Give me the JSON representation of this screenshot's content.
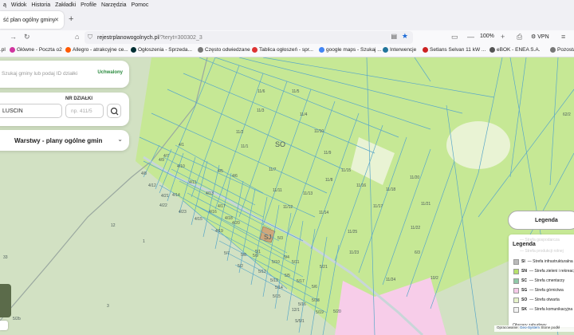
{
  "menu": [
    "ą",
    "Widok",
    "Historia",
    "Zakładki",
    "Profile",
    "Narzędzia",
    "Pomoc"
  ],
  "tab": {
    "title": "ść plan ogólny gminy"
  },
  "url": {
    "domain": "rejestrplanowogolnych.pl",
    "path": "/?teryt=300302_3",
    "zoom": "100%",
    "vpn": "VPN"
  },
  "bookmarks": [
    {
      "label": ".pl",
      "color": "#d33"
    },
    {
      "label": "Główne - Poczta o2",
      "color": "#d0359f"
    },
    {
      "label": "Allegro - atrakcyjne ce...",
      "color": "#ff5a00"
    },
    {
      "label": "Ogłoszenia - Sprzeda...",
      "color": "#002f34"
    },
    {
      "label": "Często odwiedzane",
      "color": "#777"
    },
    {
      "label": "Tablica ogłoszeń - spr...",
      "color": "#d33"
    },
    {
      "label": "google maps - Szukaj ...",
      "color": "#4285f4"
    },
    {
      "label": "Interwencje",
      "color": "#21759b"
    },
    {
      "label": "Setlans Selvan 11 kW ...",
      "color": "#c22"
    },
    {
      "label": "eBOK - ENEA S.A.",
      "color": "#555"
    },
    {
      "label": "Pozosta",
      "color": "#777"
    }
  ],
  "search": {
    "placeholder": "Szukaj gminy lub podaj ID działki",
    "status": "Uchwalony"
  },
  "parcel_form": {
    "nr_label": "NR DZIAŁKI",
    "gmina_value": "LUSCIN",
    "nr_placeholder": "np. 411/5"
  },
  "layers": {
    "label": "Warstwy - plany ogólne gmin"
  },
  "legend": {
    "tab_label": "Legenda",
    "title": "Legenda",
    "faint_rows": [
      "— Strefa gospodarcza",
      "— Strefa produkcji rolnej"
    ],
    "items": [
      {
        "code": "SI",
        "label": "— Strefa infrastrukturalna",
        "color": "#b9b9b9"
      },
      {
        "code": "SN",
        "label": "— Strefa zieleni i rekreacji",
        "color": "#b6e06c"
      },
      {
        "code": "SC",
        "label": "— Strefa cmentarzy",
        "color": "#8fc9a8"
      },
      {
        "code": "SG",
        "label": "— Strefa górnictwa",
        "color": "#f6c9e8"
      },
      {
        "code": "SO",
        "label": "— Strefa otwarta",
        "color": "#e5f2c8"
      },
      {
        "code": "SK",
        "label": "— Strefa komunikacyjna",
        "color": "#f2f2f2"
      }
    ],
    "footer": "Obszary zabudowy"
  },
  "attribution": {
    "a": "Opracowanie:",
    "b": "Geo-System",
    "c": "Stone podkł"
  },
  "map_labels": {
    "zone_so": "SO",
    "zone_sj": "SJ",
    "parcels": [
      "11/6",
      "11/5",
      "11/4",
      "11/3",
      "11/2",
      "11/1",
      "11/10",
      "11/9",
      "11/8",
      "11/7",
      "11/11",
      "11/12",
      "11/13",
      "11/14",
      "11/15",
      "11/16",
      "11/17",
      "11/18",
      "11/20",
      "11/21",
      "11/22",
      "11/23",
      "11/24",
      "11/25",
      "4/1",
      "4/7",
      "4/10",
      "4/5",
      "4/6",
      "4/8",
      "4/9",
      "4/11",
      "4/12",
      "4/13",
      "4/14",
      "4/15",
      "4/16",
      "4/17",
      "4/18",
      "4/19",
      "4/20",
      "4/21",
      "4/22",
      "4/23",
      "5/1",
      "5/2",
      "5/3",
      "5/4",
      "5/5",
      "5/6",
      "5/7",
      "5/8",
      "5/9",
      "5/10",
      "5/11",
      "5/12",
      "5/13",
      "5/14",
      "5/15",
      "5/16",
      "5/17",
      "5/18",
      "5/19",
      "5/20",
      "5/21",
      "10/2",
      "6/3",
      "12",
      "1",
      "3",
      "33",
      "12/1",
      "62/2",
      "5/2b",
      "S/5/1",
      "10/4",
      "9/4"
    ]
  }
}
